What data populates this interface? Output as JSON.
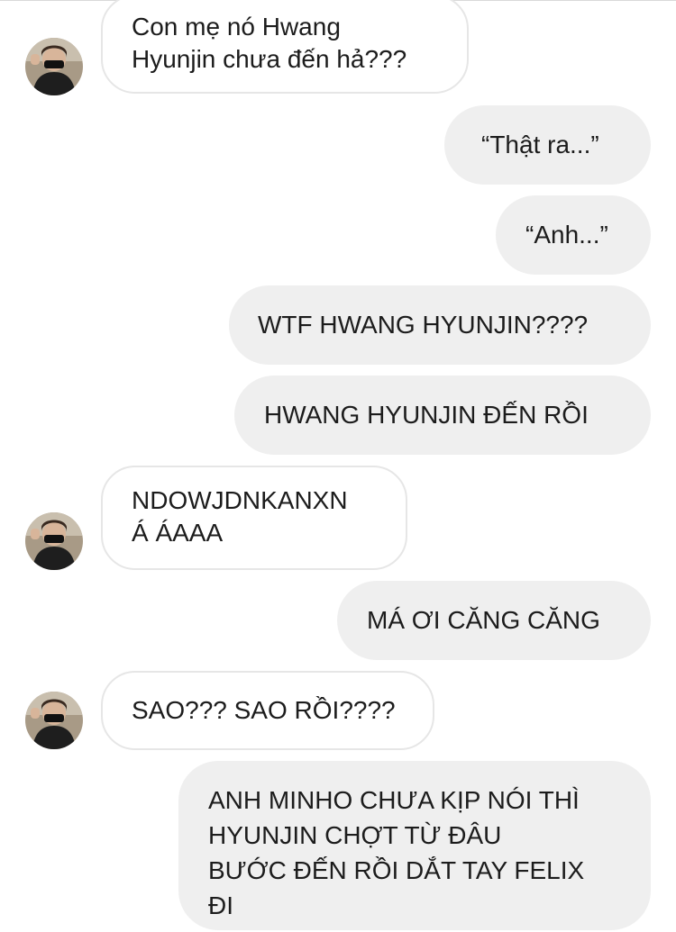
{
  "chat": {
    "messages": [
      {
        "sender": "them",
        "lines": [
          "Con mẹ nó Hwang",
          "Hyunjin chưa đến hả???"
        ]
      },
      {
        "sender": "me",
        "lines": [
          "“Thật ra...”"
        ]
      },
      {
        "sender": "me",
        "lines": [
          "“Anh...”"
        ]
      },
      {
        "sender": "me",
        "lines": [
          "WTF HWANG HYUNJIN????"
        ]
      },
      {
        "sender": "me",
        "lines": [
          "HWANG HYUNJIN ĐẾN RỒI"
        ]
      },
      {
        "sender": "them",
        "lines": [
          "NDOWJDNKANXN",
          "Á ÁAAA"
        ]
      },
      {
        "sender": "me",
        "lines": [
          "MÁ ƠI CĂNG CĂNG"
        ]
      },
      {
        "sender": "them",
        "lines": [
          "SAO??? SAO RỒI????"
        ]
      },
      {
        "sender": "me",
        "lines": [
          "ANH MINHO CHƯA KỊP NÓI THÌ",
          "HYUNJIN CHỢT TỪ ĐÂU",
          "BƯỚC ĐẾN RỒI DẮT TAY FELIX",
          "ĐI"
        ]
      }
    ]
  },
  "colors": {
    "incoming_bubble": "#ffffff",
    "incoming_border": "#e6e6e6",
    "outgoing_bubble": "#efefef",
    "text": "#1c1c1c"
  },
  "icons": {
    "avatar": "avatar-photo"
  }
}
